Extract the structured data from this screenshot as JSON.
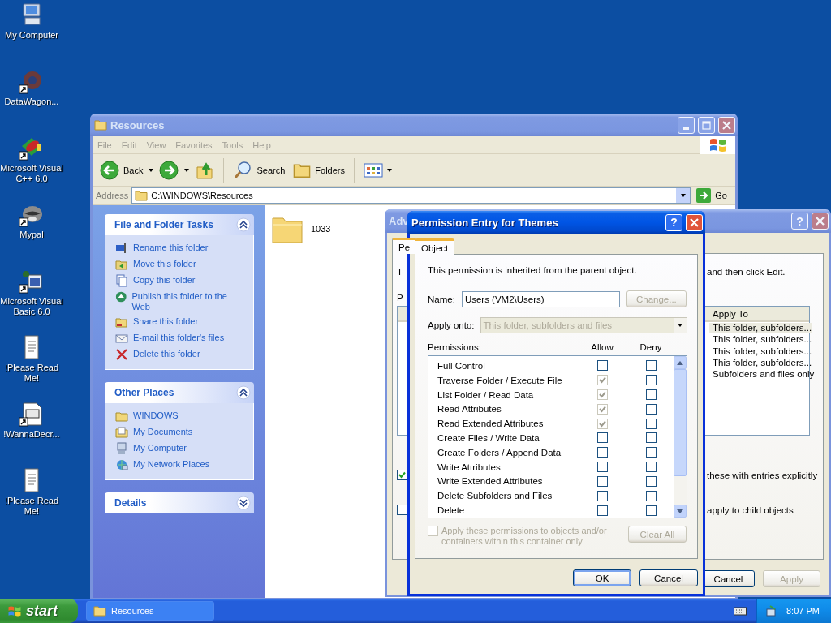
{
  "desktop_icons": [
    {
      "label": "My Computer",
      "kind": "computer",
      "shortcut": false
    },
    {
      "label": "DataWagon...",
      "kind": "gear",
      "shortcut": true
    },
    {
      "label": "Microsoft Visual C++ 6.0",
      "kind": "cpp",
      "shortcut": true
    },
    {
      "label": "Mypal",
      "kind": "animal",
      "shortcut": true
    },
    {
      "label": "Microsoft Visual Basic 6.0",
      "kind": "vb",
      "shortcut": true
    },
    {
      "label": "!Please Read Me!",
      "kind": "notepad",
      "shortcut": false
    },
    {
      "label": "!WannaDecr...",
      "kind": "appwindow",
      "shortcut": true
    },
    {
      "label": "!Please Read Me!",
      "kind": "notepad",
      "shortcut": false
    }
  ],
  "explorer": {
    "title": "Resources",
    "active": false,
    "menu": [
      "File",
      "Edit",
      "View",
      "Favorites",
      "Tools",
      "Help"
    ],
    "toolbar": {
      "back": "Back",
      "search": "Search",
      "folders": "Folders"
    },
    "address": {
      "label": "Address",
      "value": "C:\\WINDOWS\\Resources",
      "go": "Go"
    },
    "task_panels": [
      {
        "title": "File and Folder Tasks",
        "expanded": true,
        "items": [
          {
            "label": "Rename this folder",
            "kind": "rename"
          },
          {
            "label": "Move this folder",
            "kind": "move"
          },
          {
            "label": "Copy this folder",
            "kind": "copy"
          },
          {
            "label": "Publish this folder to the Web",
            "kind": "publish"
          },
          {
            "label": "Share this folder",
            "kind": "share"
          },
          {
            "label": "E-mail this folder's files",
            "kind": "email"
          },
          {
            "label": "Delete this folder",
            "kind": "delete"
          }
        ]
      },
      {
        "title": "Other Places",
        "expanded": true,
        "items": [
          {
            "label": "WINDOWS",
            "kind": "folder"
          },
          {
            "label": "My Documents",
            "kind": "documents"
          },
          {
            "label": "My Computer",
            "kind": "computer"
          },
          {
            "label": "My Network Places",
            "kind": "network"
          }
        ]
      },
      {
        "title": "Details",
        "expanded": false
      }
    ],
    "files": [
      {
        "name": "1033"
      }
    ]
  },
  "advanced_dialog": {
    "title": "Adv",
    "active": false,
    "help": "?",
    "tabs": [
      {
        "label": "Pe",
        "selected": true
      }
    ],
    "intro_start": "T",
    "intro_end": "and then click Edit.",
    "list_label_start": "P",
    "column": "Apply To",
    "entries": [
      {
        "apply_to": "This folder, subfolders...",
        "selected": true
      },
      {
        "apply_to": "This folder, subfolders...",
        "selected": false
      },
      {
        "apply_to": "This folder, subfolders...",
        "selected": false
      },
      {
        "apply_to": "This folder, subfolders...",
        "selected": false
      },
      {
        "apply_to": "Subfolders and files only",
        "selected": false
      }
    ],
    "options": [
      {
        "label": "these with entries explicitly",
        "checked": true
      },
      {
        "label": "apply to child objects",
        "checked": false
      }
    ],
    "buttons": [
      {
        "label": "Cancel",
        "disabled": false
      },
      {
        "label": "Apply",
        "disabled": true
      }
    ]
  },
  "permission_dialog": {
    "title": "Permission Entry for Themes",
    "active": true,
    "help": "?",
    "tabs": [
      {
        "label": "Object",
        "selected": true
      }
    ],
    "inherited_note": "This permission is inherited from the parent object.",
    "name": {
      "label": "Name:",
      "value": "Users (VM2\\Users)"
    },
    "change_button": {
      "label": "Change...",
      "disabled": true
    },
    "apply_onto": {
      "label": "Apply onto:",
      "value": "This folder, subfolders and files",
      "disabled": true
    },
    "permissions_label": "Permissions:",
    "allow_heading": "Allow",
    "deny_heading": "Deny",
    "permissions": [
      {
        "name": "Full Control",
        "allow": {
          "checked": false,
          "disabled": false
        },
        "deny": {
          "checked": false,
          "disabled": false
        }
      },
      {
        "name": "Traverse Folder / Execute File",
        "allow": {
          "checked": true,
          "disabled": true
        },
        "deny": {
          "checked": false,
          "disabled": false
        }
      },
      {
        "name": "List Folder / Read Data",
        "allow": {
          "checked": true,
          "disabled": true
        },
        "deny": {
          "checked": false,
          "disabled": false
        }
      },
      {
        "name": "Read Attributes",
        "allow": {
          "checked": true,
          "disabled": true
        },
        "deny": {
          "checked": false,
          "disabled": false
        }
      },
      {
        "name": "Read Extended Attributes",
        "allow": {
          "checked": true,
          "disabled": true
        },
        "deny": {
          "checked": false,
          "disabled": false
        }
      },
      {
        "name": "Create Files / Write Data",
        "allow": {
          "checked": false,
          "disabled": false
        },
        "deny": {
          "checked": false,
          "disabled": false
        }
      },
      {
        "name": "Create Folders / Append Data",
        "allow": {
          "checked": false,
          "disabled": false
        },
        "deny": {
          "checked": false,
          "disabled": false
        }
      },
      {
        "name": "Write Attributes",
        "allow": {
          "checked": false,
          "disabled": false
        },
        "deny": {
          "checked": false,
          "disabled": false
        }
      },
      {
        "name": "Write Extended Attributes",
        "allow": {
          "checked": false,
          "disabled": false
        },
        "deny": {
          "checked": false,
          "disabled": false
        }
      },
      {
        "name": "Delete Subfolders and Files",
        "allow": {
          "checked": false,
          "disabled": false
        },
        "deny": {
          "checked": false,
          "disabled": false
        }
      },
      {
        "name": "Delete",
        "allow": {
          "checked": false,
          "disabled": false
        },
        "deny": {
          "checked": false,
          "disabled": false
        }
      }
    ],
    "apply_within": {
      "label": "Apply these permissions to objects and/or containers within this container only",
      "checked": false,
      "disabled": true
    },
    "clear_all": {
      "label": "Clear All",
      "disabled": true
    },
    "buttons": [
      {
        "label": "OK",
        "default": true
      },
      {
        "label": "Cancel",
        "default": false
      }
    ]
  },
  "taskbar": {
    "start": "start",
    "tasks": [
      {
        "label": "Resources",
        "selected": false
      }
    ],
    "clock": "8:07 PM"
  }
}
